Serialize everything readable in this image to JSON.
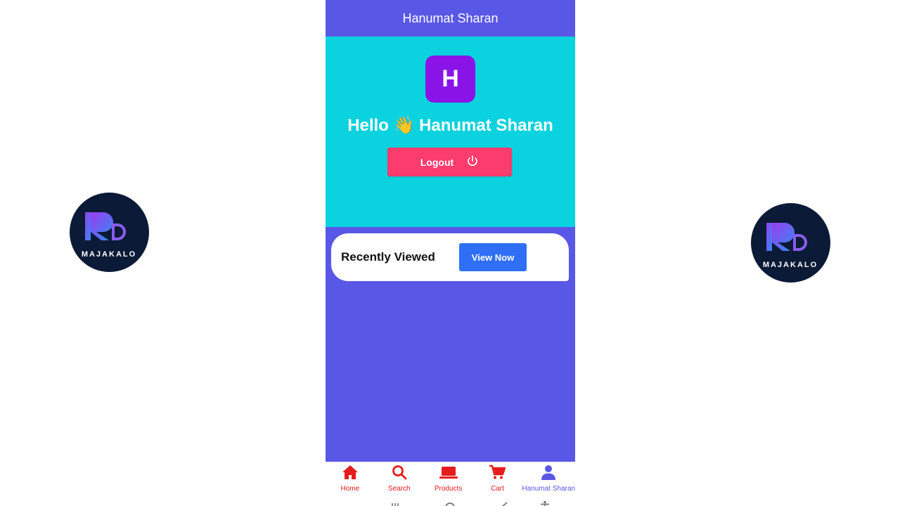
{
  "header": {
    "title": "Hanumat Sharan"
  },
  "profile": {
    "avatar_letter": "H",
    "greeting": "Hello 👋 Hanumat Sharan",
    "logout_label": "Logout"
  },
  "recent": {
    "title": "Recently Viewed",
    "button_label": "View Now"
  },
  "bottom_nav": {
    "items": [
      {
        "label": "Home",
        "icon": "home-icon"
      },
      {
        "label": "Search",
        "icon": "search-icon"
      },
      {
        "label": "Products",
        "icon": "laptop-icon"
      },
      {
        "label": "Cart",
        "icon": "cart-icon"
      },
      {
        "label": "Hanumat Sharan",
        "icon": "user-icon"
      }
    ],
    "active_index": 4
  },
  "watermark": {
    "brand": "MAJAKALO"
  },
  "colors": {
    "primary": "#5957e6",
    "profile_bg": "#0ad2de",
    "avatar_bg": "#8a14e8",
    "logout_bg": "#fd3c6e",
    "view_btn_bg": "#2f6ff5",
    "nav_inactive": "#e51c1c"
  }
}
